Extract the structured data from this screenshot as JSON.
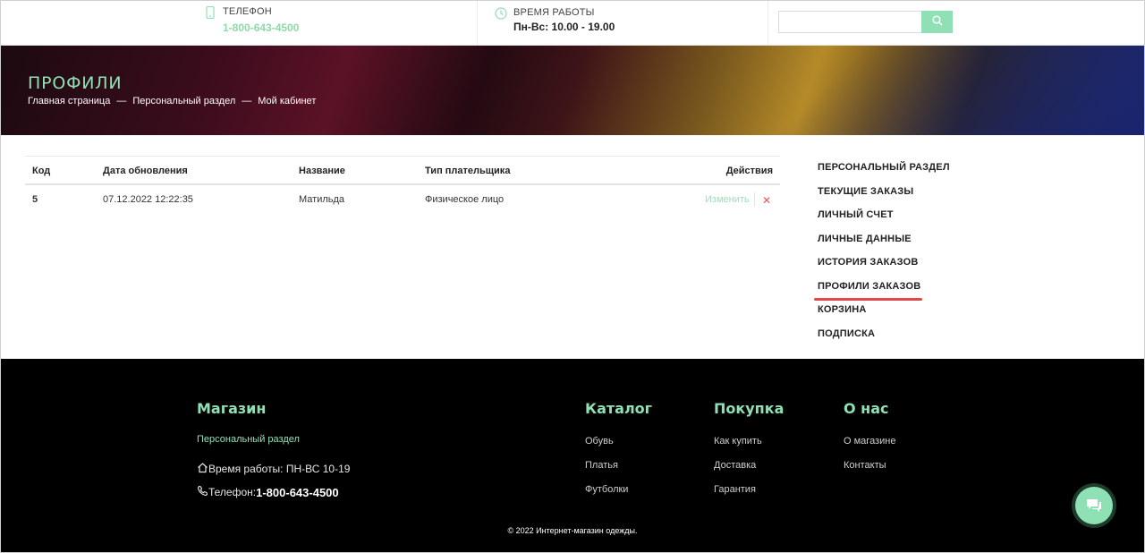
{
  "header": {
    "phone_label": "ТЕЛЕФОН",
    "phone_value": "1-800-643-4500",
    "hours_label": "ВРЕМЯ РАБОТЫ",
    "hours_value": "Пн-Вс: 10.00 - 19.00",
    "search_placeholder": "",
    "accent_color": "#8fe0b4"
  },
  "banner": {
    "title": "ПРОФИЛИ",
    "breadcrumbs": [
      "Главная страница",
      "Персональный раздел",
      "Мой кабинет"
    ],
    "separator": "—"
  },
  "table": {
    "headers": {
      "code": "Код",
      "updated": "Дата обновления",
      "name": "Название",
      "payer_type": "Тип плательщика",
      "actions": "Действия"
    },
    "rows": [
      {
        "code": "5",
        "updated": "07.12.2022 12:22:35",
        "name": "Матильда",
        "payer_type": "Физическое лицо",
        "edit_label": "Изменить",
        "delete_icon": "close-icon"
      }
    ]
  },
  "sidebar": {
    "items": [
      {
        "label": "ПЕРСОНАЛЬНЫЙ РАЗДЕЛ"
      },
      {
        "label": "ТЕКУЩИЕ ЗАКАЗЫ"
      },
      {
        "label": "ЛИЧНЫЙ СЧЕТ"
      },
      {
        "label": "ЛИЧНЫЕ ДАННЫЕ"
      },
      {
        "label": "ИСТОРИЯ ЗАКАЗОВ"
      },
      {
        "label": "ПРОФИЛИ ЗАКАЗОВ",
        "active": true
      },
      {
        "label": "КОРЗИНА"
      },
      {
        "label": "ПОДПИСКА"
      }
    ],
    "highlight_color": "#e04848"
  },
  "footer": {
    "shop": {
      "title": "Магазин",
      "link": "Персональный раздел",
      "hours": "Время работы: ПН-ВС 10-19",
      "phone_label": "Телефон: ",
      "phone_value": "1-800-643-4500"
    },
    "catalog": {
      "title": "Каталог",
      "links": [
        "Обувь",
        "Платья",
        "Футболки"
      ]
    },
    "purchase": {
      "title": "Покупка",
      "links": [
        "Как купить",
        "Доставка",
        "Гарантия"
      ]
    },
    "about": {
      "title": "О нас",
      "links": [
        "О магазине",
        "Контакты"
      ]
    },
    "copyright": "© 2022 Интернет-магазин одежды."
  },
  "chat": {
    "icon": "chat-icon"
  }
}
